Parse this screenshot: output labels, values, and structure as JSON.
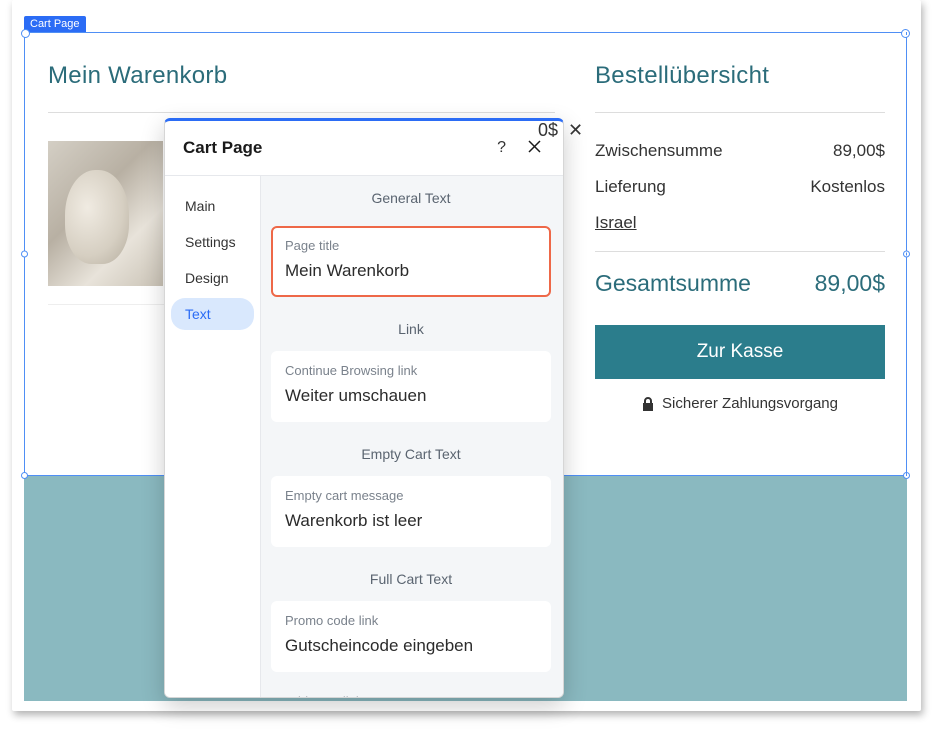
{
  "selection_label": "Cart Page",
  "cart": {
    "title": "Mein Warenkorb",
    "price_fragment": "0$",
    "price_close": "✕"
  },
  "summary": {
    "title": "Bestellübersicht",
    "subtotal_label": "Zwischensumme",
    "subtotal_value": "89,00$",
    "shipping_label": "Lieferung",
    "shipping_value": "Kostenlos",
    "shipping_destination": "Israel",
    "total_label": "Gesamtsumme",
    "total_value": "89,00$",
    "checkout_button": "Zur Kasse",
    "secure_text": "Sicherer Zahlungsvorgang"
  },
  "panel": {
    "title": "Cart Page",
    "tabs": {
      "main": "Main",
      "settings": "Settings",
      "design": "Design",
      "text": "Text"
    },
    "sections": {
      "general_text": "General Text",
      "page_title_label": "Page title",
      "page_title_value": "Mein Warenkorb",
      "link": "Link",
      "continue_label": "Continue Browsing link",
      "continue_value": "Weiter umschauen",
      "empty_cart": "Empty Cart Text",
      "empty_msg_label": "Empty cart message",
      "empty_msg_value": "Warenkorb ist leer",
      "full_cart": "Full Cart Text",
      "promo_label": "Promo code link",
      "promo_value": "Gutscheincode eingeben",
      "addnote_label": "Add Note link"
    }
  }
}
